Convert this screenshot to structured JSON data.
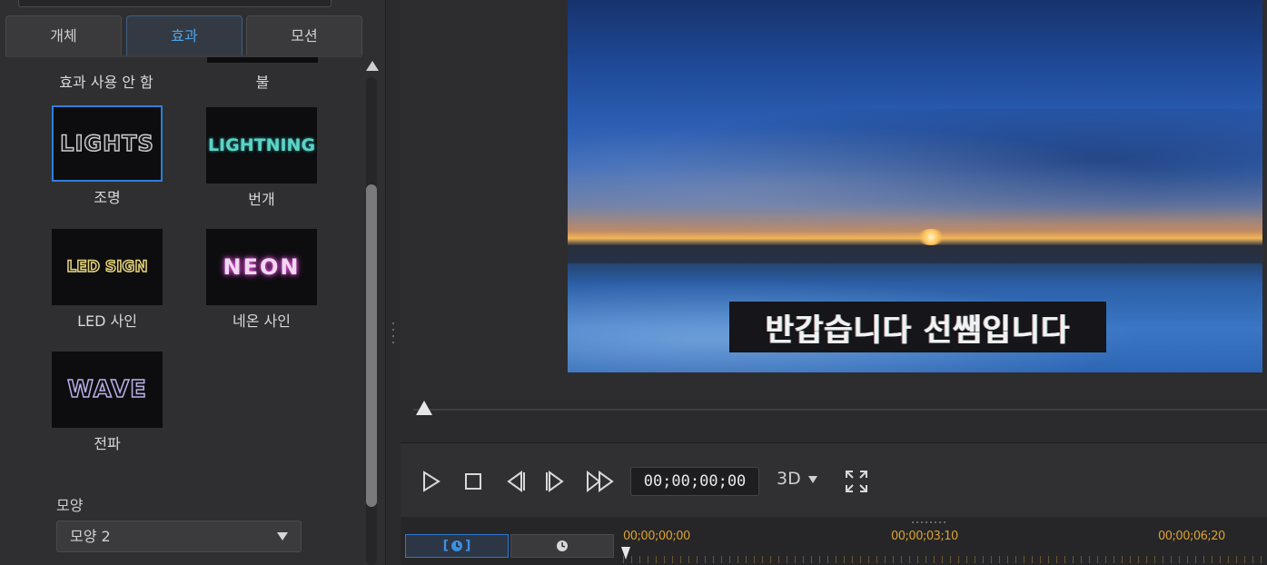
{
  "tabs": [
    {
      "label": "개체",
      "active": false
    },
    {
      "label": "효과",
      "active": true
    },
    {
      "label": "모션",
      "active": false
    }
  ],
  "effects": {
    "top_labels": {
      "no_effect": "효과 사용 안 함",
      "fire": "불"
    },
    "items": [
      {
        "thumb_text": "LIGHTS",
        "label": "조명",
        "selected": true
      },
      {
        "thumb_text": "LIGHTNING",
        "label": "번개",
        "selected": false
      },
      {
        "thumb_text": "LED SIGN",
        "label": "LED 사인",
        "selected": false
      },
      {
        "thumb_text": "NEON",
        "label": "네온 사인",
        "selected": false
      },
      {
        "thumb_text": "WAVE",
        "label": "전파",
        "selected": false
      }
    ]
  },
  "shape": {
    "label": "모양",
    "value": "모양 2"
  },
  "preview": {
    "caption": "반갑습니다 선쌤입니다"
  },
  "controls": {
    "timecode": "00;00;00;00",
    "mode": "3D"
  },
  "timeline": {
    "timecodes": [
      "00;00;00;00",
      "00;00;03;10",
      "00;00;06;20"
    ]
  },
  "colors": {
    "accent": "#2e7fd8",
    "timecode_ruler": "#d9a033"
  }
}
